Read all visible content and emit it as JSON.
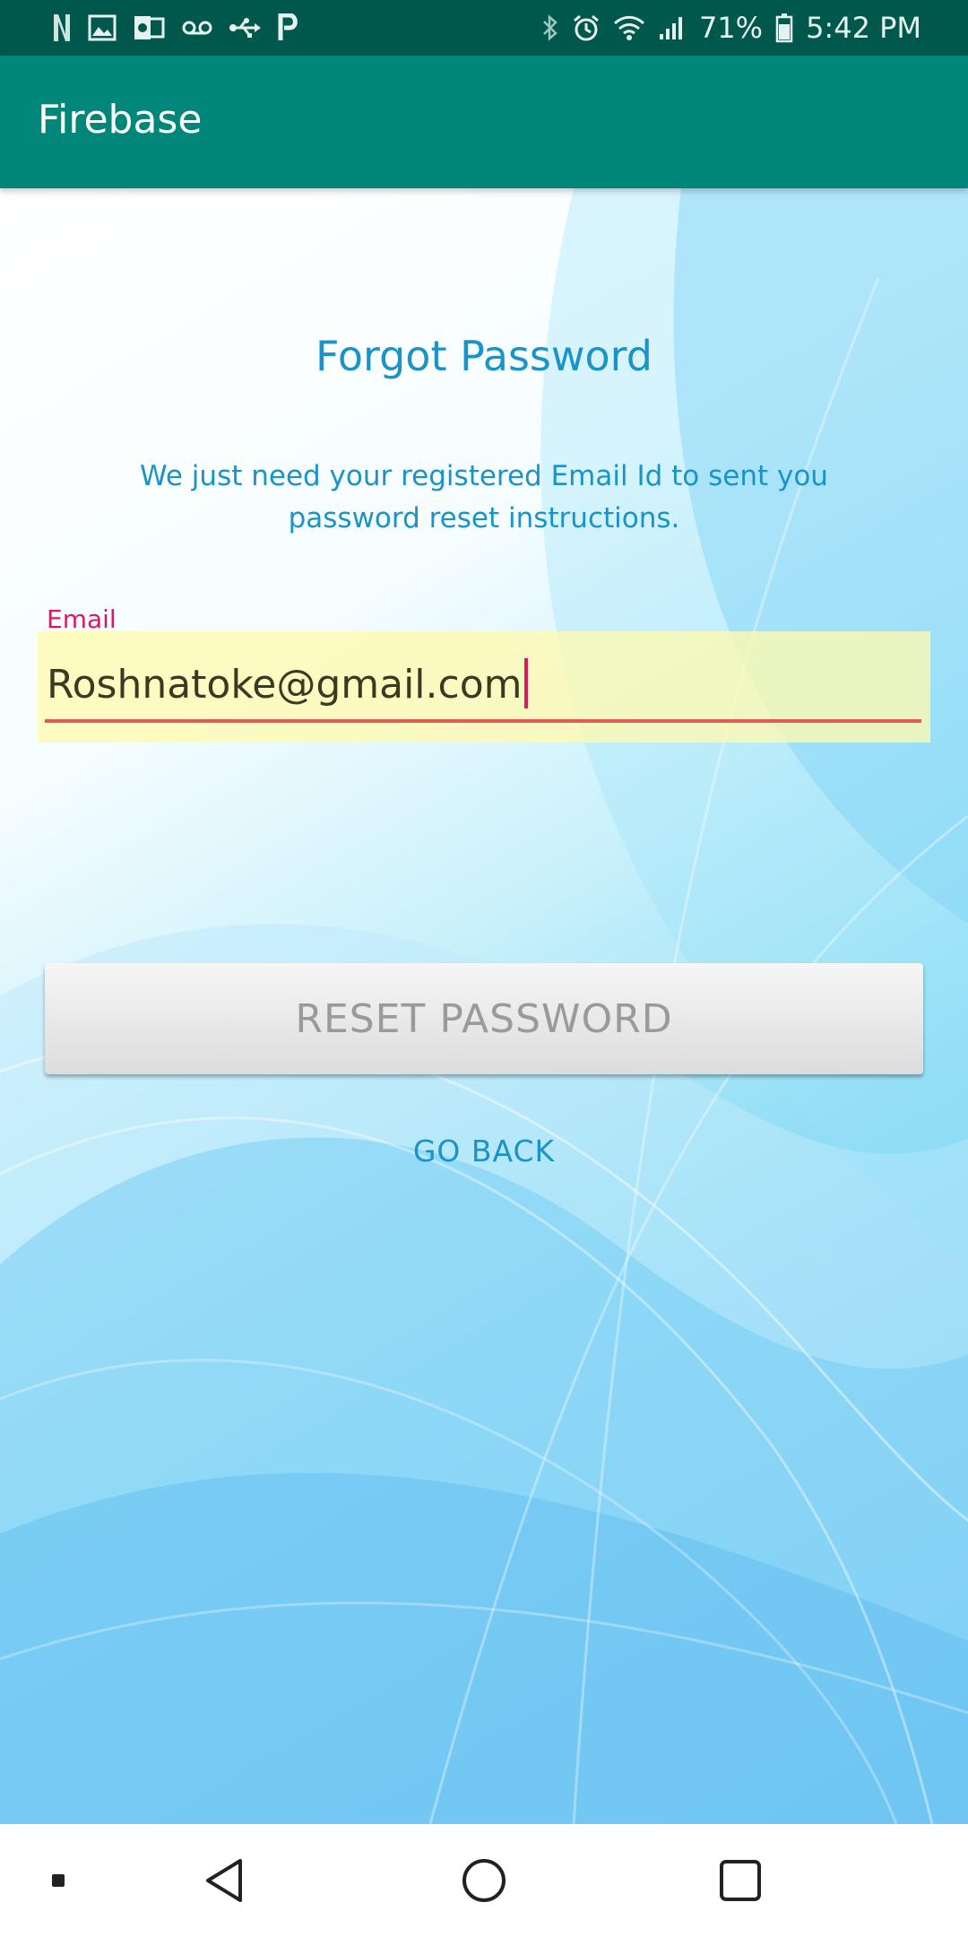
{
  "status_bar": {
    "left_icons": [
      "netflix-icon",
      "image-icon",
      "outlook-icon",
      "voicemail-icon",
      "usb-icon",
      "parking-icon"
    ],
    "right_icons": [
      "bluetooth-icon",
      "alarm-icon",
      "wifi-icon",
      "signal-icon",
      "battery-icon"
    ],
    "battery_percent": "71%",
    "time": "5:42 PM"
  },
  "app_bar": {
    "title": "Firebase"
  },
  "form": {
    "title": "Forgot Password",
    "instructions": "We just need your registered Email Id to sent you password reset instructions.",
    "email_label": "Email",
    "email_value": "Roshnatoke@gmail.com",
    "reset_button_label": "RESET PASSWORD",
    "go_back_label": "GO BACK"
  },
  "nav_bar": {
    "items": [
      "dot-icon",
      "back-icon",
      "home-icon",
      "recents-icon"
    ]
  },
  "colors": {
    "status_bar": "#00574b",
    "app_bar": "#00877a",
    "accent_text": "#1a93c8",
    "email_label": "#d81b60",
    "field_highlight": "#fffaaf",
    "underline": "#e05a5a",
    "button": "#e6e6e6",
    "button_text": "#9a9a9a"
  }
}
